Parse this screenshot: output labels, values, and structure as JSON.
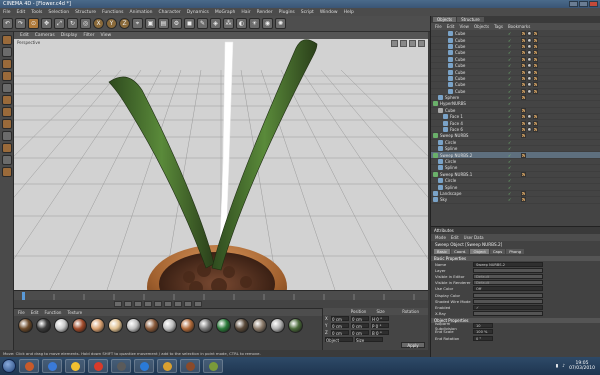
{
  "window": {
    "title": "CINEMA 4D - [Flower.c4d *]"
  },
  "menu": [
    "File",
    "Edit",
    "Tools",
    "Selection",
    "Structure",
    "Functions",
    "Animation",
    "Character",
    "Dynamics",
    "MoGraph",
    "Hair",
    "Render",
    "Plugins",
    "Script",
    "Window",
    "Help"
  ],
  "viewport": {
    "menu": [
      "Edit",
      "Cameras",
      "Display",
      "Filter",
      "View"
    ],
    "label": "Perspective"
  },
  "objects": {
    "tabs": [
      "Objects",
      "Structure"
    ],
    "menu": [
      "File",
      "Edit",
      "View",
      "Objects",
      "Tags",
      "Bookmarks"
    ],
    "rows": [
      {
        "name": "Cube",
        "indent": 3,
        "tags": 3
      },
      {
        "name": "Cube",
        "indent": 3,
        "tags": 3
      },
      {
        "name": "Cube",
        "indent": 3,
        "tags": 3
      },
      {
        "name": "Cube",
        "indent": 3,
        "tags": 3
      },
      {
        "name": "Cube",
        "indent": 3,
        "tags": 3
      },
      {
        "name": "Cube",
        "indent": 3,
        "tags": 3
      },
      {
        "name": "Cube",
        "indent": 3,
        "tags": 3
      },
      {
        "name": "Cube",
        "indent": 3,
        "tags": 3
      },
      {
        "name": "Cube",
        "indent": 3,
        "tags": 3
      },
      {
        "name": "Cube",
        "indent": 3,
        "tags": 3
      },
      {
        "name": "Sphere",
        "indent": 1,
        "tags": 1
      },
      {
        "name": "HyperNURBS",
        "indent": 0,
        "tags": 0
      },
      {
        "name": "Cube",
        "indent": 1,
        "tags": 1
      },
      {
        "name": "Face 1",
        "indent": 2,
        "tags": 3
      },
      {
        "name": "Face 4",
        "indent": 2,
        "tags": 3
      },
      {
        "name": "Face 6",
        "indent": 2,
        "tags": 3
      },
      {
        "name": "Sweep NURBS",
        "indent": 0,
        "tags": 1
      },
      {
        "name": "Circle",
        "indent": 1,
        "tags": 0
      },
      {
        "name": "Spline",
        "indent": 1,
        "tags": 0
      },
      {
        "name": "Sweep NURBS.2",
        "indent": 0,
        "tags": 1
      },
      {
        "name": "Circle",
        "indent": 1,
        "tags": 0
      },
      {
        "name": "Spline",
        "indent": 1,
        "tags": 0
      },
      {
        "name": "Sweep NURBS.1",
        "indent": 0,
        "tags": 1
      },
      {
        "name": "Circle",
        "indent": 1,
        "tags": 0
      },
      {
        "name": "Spline",
        "indent": 1,
        "tags": 0
      },
      {
        "name": "Landscape",
        "indent": 0,
        "tags": 1
      },
      {
        "name": "Sky",
        "indent": 0,
        "tags": 1
      }
    ]
  },
  "attributes": {
    "header": "Attributes",
    "menu": [
      "Mode",
      "Edit",
      "User Data"
    ],
    "object": "Sweep Object [Sweep NURBS.2]",
    "tabs": [
      "Basic",
      "Coord.",
      "Object",
      "Caps",
      "Phong"
    ],
    "basic_header": "Basic Properties",
    "basic": [
      {
        "label": "Name",
        "value": "Sweep NURBS.2"
      },
      {
        "label": "Layer",
        "value": ""
      },
      {
        "label": "Visible in Editor",
        "value": "Default"
      },
      {
        "label": "Visible in Renderer",
        "value": "Default"
      },
      {
        "label": "Use Color",
        "value": "Off"
      },
      {
        "label": "Display Color",
        "value": ""
      },
      {
        "label": "Shaded Wire Mode",
        "value": ""
      },
      {
        "label": "Enabled",
        "value": "✓"
      },
      {
        "label": "X-Ray",
        "value": ""
      }
    ],
    "object_header": "Object Properties",
    "object_props": [
      {
        "label": "Isoparm Subdivision",
        "value": "10"
      },
      {
        "label": "End Scale",
        "value": "100 %"
      },
      {
        "label": "End Rotation",
        "value": "0 °"
      }
    ]
  },
  "coords": {
    "headers": [
      "Position",
      "Size",
      "Rotation"
    ],
    "rows": [
      {
        "axis": "X",
        "pos": "0 cm",
        "size": "0 cm",
        "rot": "H 0 °"
      },
      {
        "axis": "Y",
        "pos": "0 cm",
        "size": "0 cm",
        "rot": "P 0 °"
      },
      {
        "axis": "Z",
        "pos": "0 cm",
        "size": "0 cm",
        "rot": "B 0 °"
      }
    ],
    "mode": "Object",
    "size_mode": "Size",
    "apply": "Apply"
  },
  "materials": {
    "menu": [
      "File",
      "Edit",
      "Function",
      "Texture"
    ],
    "swatches": [
      "#6b4a2a",
      "#3c3c3c",
      "#c8c8c8",
      "#a04a2a",
      "#d8a070",
      "#e0c090",
      "#bfbfbf",
      "#8a5a3a",
      "#c0c0c0",
      "#b06a3a",
      "#7a7a7a",
      "#2a7a3a",
      "#5a4a3a",
      "#8a7a6a",
      "#b0b0b0",
      "#4a6a3a"
    ]
  },
  "status": "Move: Click and drag to move elements. Hold down SHIFT to quantize movement / add to the selection in point mode, CTRL to remove.",
  "taskbar": {
    "apps": [
      "#c85a2a",
      "#3a7ad8",
      "#f2c030",
      "#d83a2a",
      "#5a5a5a",
      "#2a7ad8",
      "#d8a030",
      "#8a4a2a",
      "#7a9a3a"
    ],
    "time": "19:05",
    "date": "07/03/2010"
  }
}
